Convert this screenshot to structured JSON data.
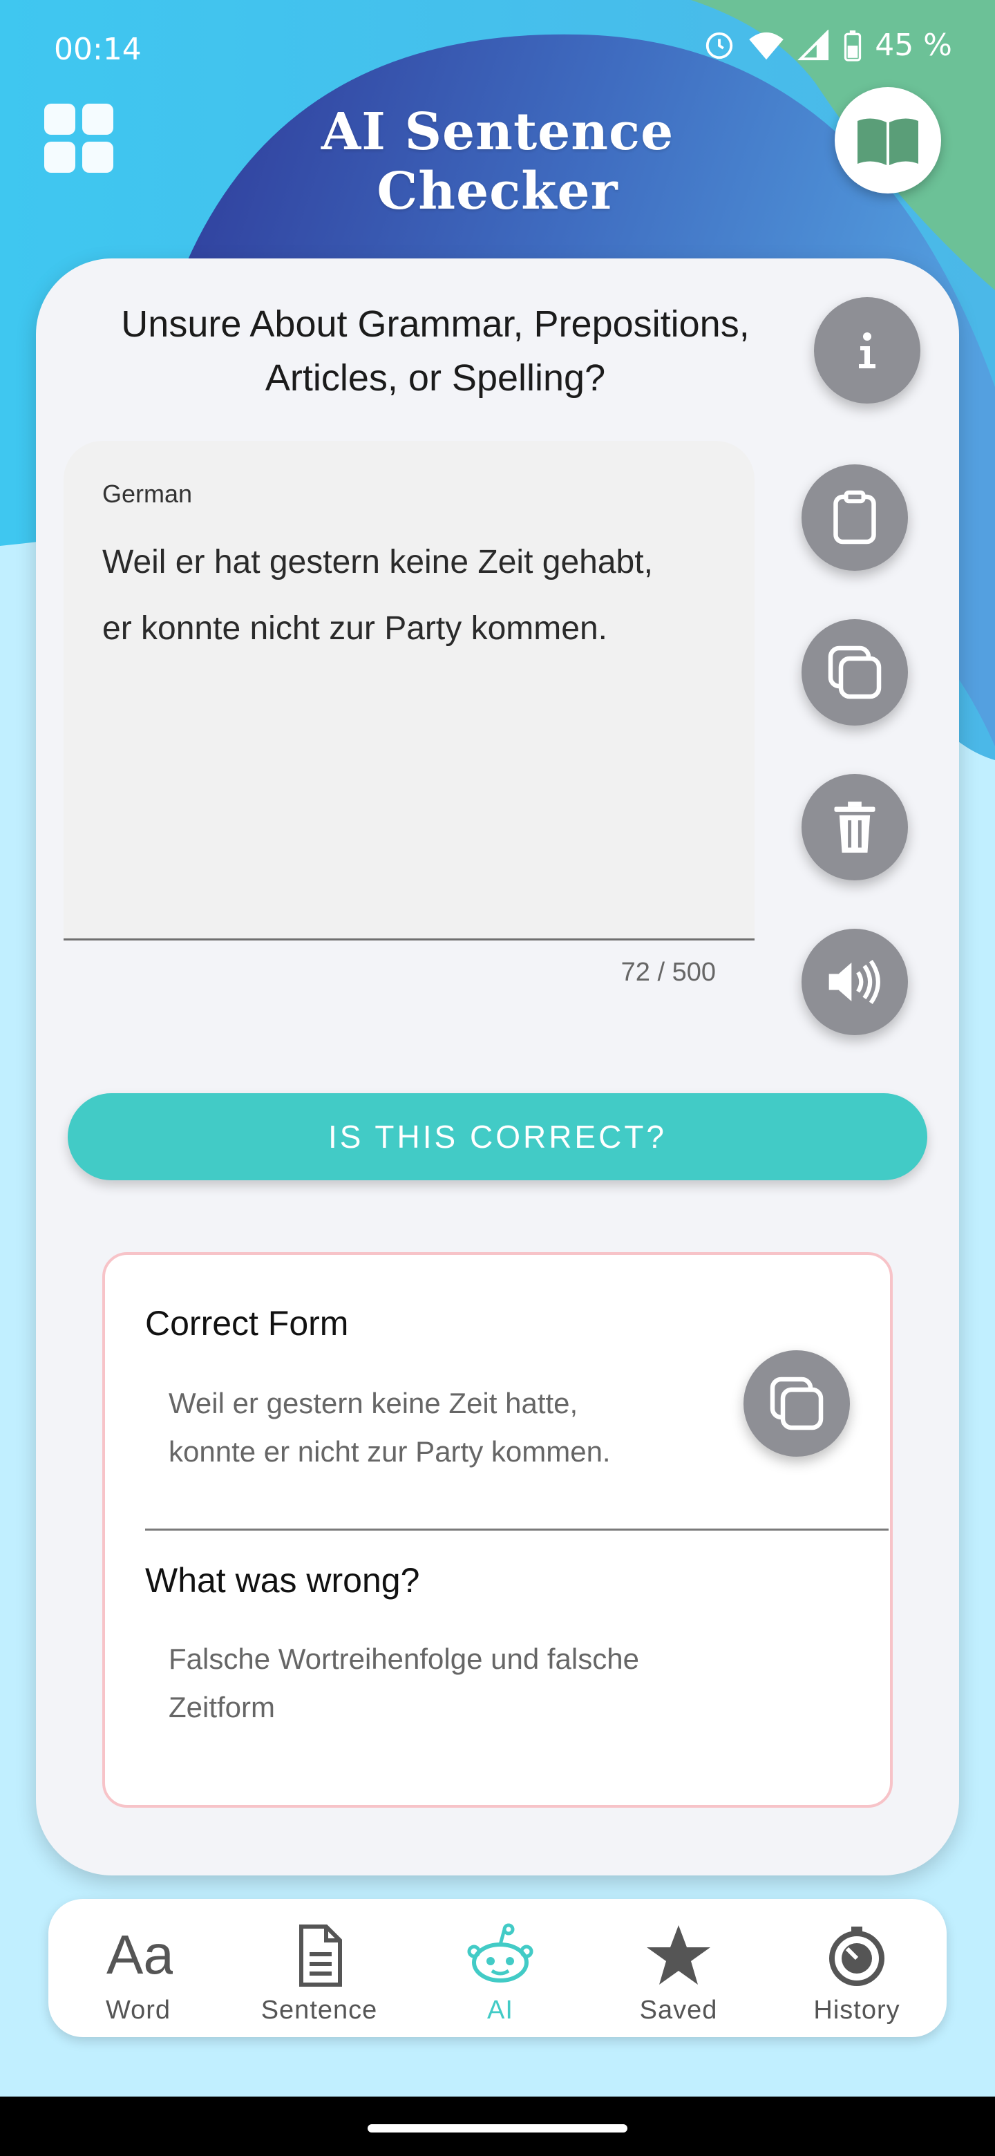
{
  "status_bar": {
    "time": "00:14",
    "battery": "45 %"
  },
  "header": {
    "title": "AI Sentence Checker",
    "menu_icon": "grid-icon",
    "dictionary_icon": "open-book-icon"
  },
  "card": {
    "heading_line1": "Unsure About Grammar, Prepositions,",
    "heading_line2": "Articles, or Spelling?",
    "info_icon": "info-icon",
    "input": {
      "language": "German",
      "text_line1": "Weil er hat gestern keine Zeit gehabt,",
      "text_line2": "er konnte nicht zur Party kommen.",
      "char_count": "72 / 500"
    },
    "actions": [
      "paste-icon",
      "copy-icon",
      "trash-icon",
      "speaker-icon"
    ],
    "check_button_label": "IS THIS CORRECT?"
  },
  "result": {
    "correct_title": "Correct Form",
    "correct_line1": "Weil er gestern keine Zeit hatte,",
    "correct_line2": "konnte er nicht zur Party kommen.",
    "wrong_title": "What was wrong?",
    "wrong_line1": "Falsche Wortreihenfolge und falsche",
    "wrong_line2": "Zeitform"
  },
  "bottom_nav": {
    "items": [
      {
        "label": "Word",
        "icon": "aa-text-icon",
        "active": false
      },
      {
        "label": "Sentence",
        "icon": "document-icon",
        "active": false
      },
      {
        "label": "AI",
        "icon": "robot-icon",
        "active": true
      },
      {
        "label": "Saved",
        "icon": "star-icon",
        "active": false
      },
      {
        "label": "History",
        "icon": "clock-icon",
        "active": false
      }
    ]
  },
  "colors": {
    "accent": "#42cbc6",
    "result_border": "#f7c3c8",
    "button_gray": "#8e8f95"
  }
}
